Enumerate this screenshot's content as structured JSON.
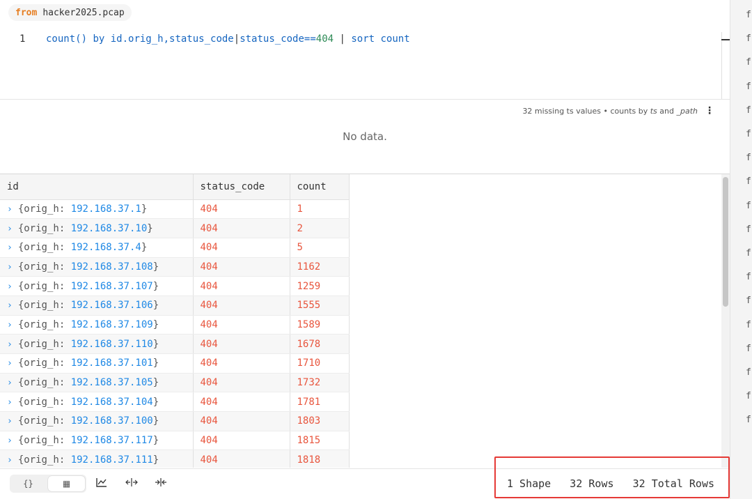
{
  "source": {
    "keyword": "from",
    "file": "hacker2025.pcap"
  },
  "editor": {
    "line_number": "1",
    "query_tokens": [
      {
        "t": "count()",
        "c": "q-fn"
      },
      {
        "t": " by ",
        "c": "q-kw"
      },
      {
        "t": "id.orig_h,status_code",
        "c": "q-fld"
      },
      {
        "t": "|",
        "c": "q-pipe"
      },
      {
        "t": "status_code==",
        "c": "q-fld"
      },
      {
        "t": "404",
        "c": "q-num"
      },
      {
        "t": " | ",
        "c": "q-pipe"
      },
      {
        "t": "sort count",
        "c": "q-kw"
      }
    ]
  },
  "chart": {
    "info_prefix": "32 missing ts values • counts by ",
    "info_ts": "ts",
    "info_and": " and ",
    "info_path": "_path",
    "menu_icon": "⋮",
    "empty_text": "No data."
  },
  "table": {
    "headers": {
      "id": "id",
      "status_code": "status_code",
      "count": "count"
    },
    "rows": [
      {
        "ip": "192.168.37.1",
        "status_code": "404",
        "count": "1"
      },
      {
        "ip": "192.168.37.10",
        "status_code": "404",
        "count": "2"
      },
      {
        "ip": "192.168.37.4",
        "status_code": "404",
        "count": "5"
      },
      {
        "ip": "192.168.37.108",
        "status_code": "404",
        "count": "1162"
      },
      {
        "ip": "192.168.37.107",
        "status_code": "404",
        "count": "1259"
      },
      {
        "ip": "192.168.37.106",
        "status_code": "404",
        "count": "1555"
      },
      {
        "ip": "192.168.37.109",
        "status_code": "404",
        "count": "1589"
      },
      {
        "ip": "192.168.37.110",
        "status_code": "404",
        "count": "1678"
      },
      {
        "ip": "192.168.37.101",
        "status_code": "404",
        "count": "1710"
      },
      {
        "ip": "192.168.37.105",
        "status_code": "404",
        "count": "1732"
      },
      {
        "ip": "192.168.37.104",
        "status_code": "404",
        "count": "1781"
      },
      {
        "ip": "192.168.37.100",
        "status_code": "404",
        "count": "1803"
      },
      {
        "ip": "192.168.37.117",
        "status_code": "404",
        "count": "1815"
      },
      {
        "ip": "192.168.37.111",
        "status_code": "404",
        "count": "1818"
      }
    ],
    "field_prefix": "{orig_h: ",
    "field_suffix": "}"
  },
  "footer": {
    "view_json_label": "{}",
    "view_table_label": "▦",
    "tool_icons": [
      "chart-icon",
      "expand-icon",
      "collapse-icon"
    ],
    "stats_text": "1 Shape   32 Rows   32 Total Rows"
  },
  "sidebar": {
    "items": [
      "fi",
      "fi",
      "fi",
      "fi",
      "fi",
      "fi",
      "fi",
      "fi",
      "fi",
      "fi",
      "fi",
      "fi",
      "fi",
      "fi",
      "fi",
      "fi",
      "fi",
      "fi"
    ]
  }
}
